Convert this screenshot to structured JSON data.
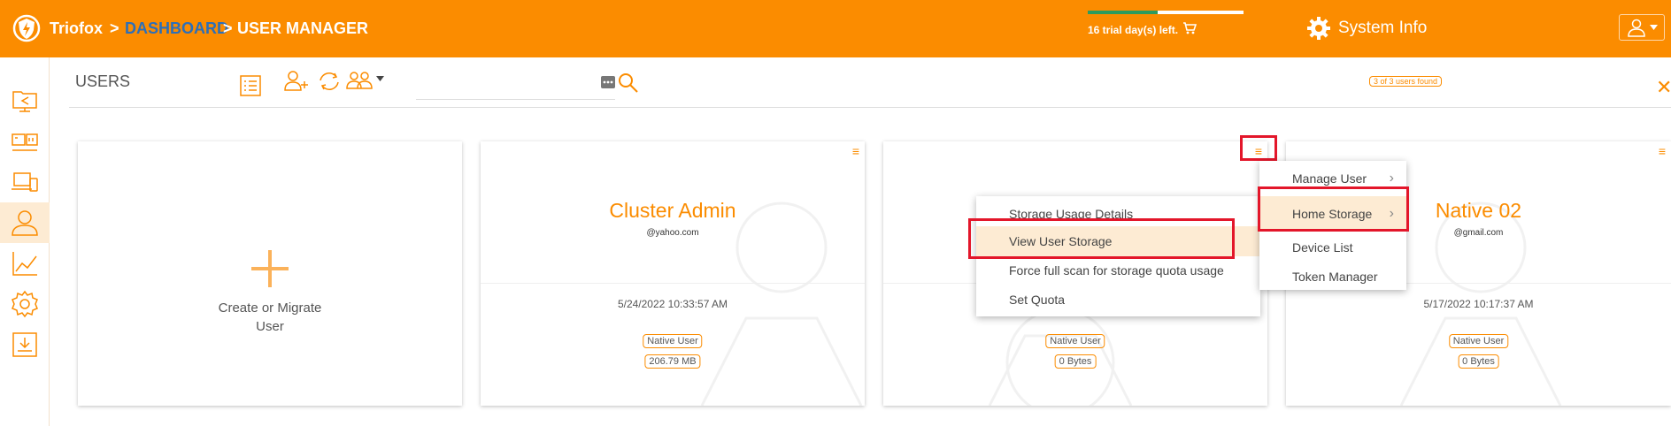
{
  "colors": {
    "brand": "#fb8c00",
    "link": "#2d6fb8",
    "highlight": "#e3162a"
  },
  "header": {
    "brand": "Triofox",
    "sep1": ">",
    "crumb_link": "DASHBOARD",
    "sep2": ">",
    "crumb_current": "USER MANAGER",
    "trial_text": "16 trial day(s) left.",
    "trial_progress": 0.45,
    "system_info": "System Info"
  },
  "sidebar": {
    "items": [
      {
        "icon": "share-folder-icon"
      },
      {
        "icon": "server-icon"
      },
      {
        "icon": "devices-icon"
      },
      {
        "icon": "users-icon",
        "active": true
      },
      {
        "icon": "chart-icon"
      },
      {
        "icon": "settings-gear-icon"
      },
      {
        "icon": "download-icon"
      }
    ]
  },
  "page": {
    "title": "USERS",
    "search_placeholder": "",
    "count": "3 of 3 users found"
  },
  "cards": [
    {
      "type": "create",
      "label_line1": "Create or Migrate",
      "label_line2": "User"
    },
    {
      "name": "Cluster Admin",
      "email": "@yahoo.com",
      "date": "5/24/2022 10:33:57 AM",
      "type": "Native User",
      "size": "206.79 MB"
    },
    {
      "name": "",
      "email": "",
      "date": "",
      "type": "Native User",
      "size": "0 Bytes"
    },
    {
      "name": "Native 02",
      "email": "@gmail.com",
      "date": "5/17/2022 10:17:37 AM",
      "type": "Native User",
      "size": "0 Bytes"
    }
  ],
  "main_menu": {
    "items": [
      "Manage User",
      "Home Storage",
      "Device List",
      "Token Manager"
    ]
  },
  "sub_menu": {
    "items": [
      "Storage Usage Details",
      "View User Storage",
      "Force full scan for storage quota usage",
      "Set Quota"
    ]
  }
}
